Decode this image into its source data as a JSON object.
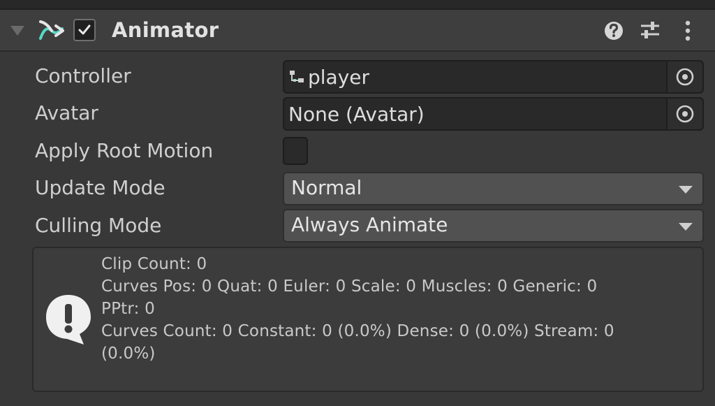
{
  "component": {
    "title": "Animator",
    "enabled": true,
    "icons": [
      "foldout-arrow-icon",
      "animator-icon",
      "help-icon",
      "preset-icon",
      "kebab-menu-icon"
    ]
  },
  "fields": {
    "controller": {
      "label": "Controller",
      "value": "player"
    },
    "avatar": {
      "label": "Avatar",
      "value": "None (Avatar)"
    },
    "apply_root_motion": {
      "label": "Apply Root Motion",
      "checked": false
    },
    "update_mode": {
      "label": "Update Mode",
      "value": "Normal"
    },
    "culling_mode": {
      "label": "Culling Mode",
      "value": "Always Animate"
    }
  },
  "info": {
    "line1": "Clip Count: 0",
    "line2": "Curves Pos: 0 Quat: 0 Euler: 0 Scale: 0 Muscles: 0 Generic: 0",
    "line3": "PPtr: 0",
    "line4": "Curves Count: 0 Constant: 0 (0.0%) Dense: 0 (0.0%) Stream: 0",
    "line5": "(0.0%)"
  },
  "colors": {
    "background": "#383838",
    "header": "#3e3e3e",
    "field": "#292929",
    "dropdown": "#515151",
    "accent_teal": "#4fd8c4"
  }
}
